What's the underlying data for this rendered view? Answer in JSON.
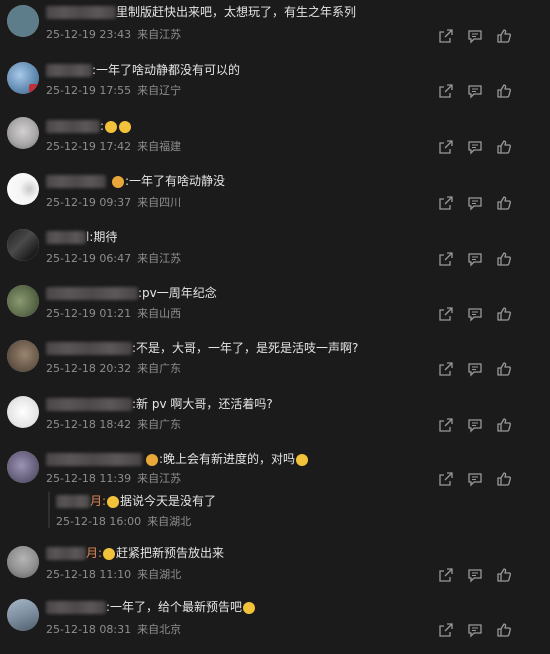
{
  "comments": [
    {
      "id": "c1",
      "avatar_color": "#5d7d8b",
      "name_tail": "",
      "text": "里制版赶快出来吧，太想玩了，有生之年系列",
      "date": "25-12-19 23:43",
      "location": "来自江苏"
    },
    {
      "id": "c2",
      "avatar_color": "#5f89b0",
      "name_tail": "",
      "text": ":一年了啥动静都没有可以的",
      "date": "25-12-19 17:55",
      "location": "来自辽宁"
    },
    {
      "id": "c3",
      "avatar_color": "#a9a7a8",
      "name_tail": "",
      "text": ":",
      "date": "25-12-19 17:42",
      "location": "来自福建"
    },
    {
      "id": "c4",
      "avatar_color": "#f0f0f0",
      "name_tail": "",
      "text": ":一年了有啥动静没",
      "date": "25-12-19 09:37",
      "location": "来自四川"
    },
    {
      "id": "c5",
      "avatar_color": "#3a3a3a",
      "name_tail": "l",
      "text": ":期待",
      "date": "25-12-19 06:47",
      "location": "来自江苏"
    },
    {
      "id": "c6",
      "avatar_color": "#6c7a58",
      "name_tail": "",
      "text": ":pv一周年纪念",
      "date": "25-12-19 01:21",
      "location": "来自山西"
    },
    {
      "id": "c7",
      "avatar_color": "#6b5b4b",
      "name_tail": "",
      "text": ":不是，大哥，一年了，是死是活吱一声啊?",
      "date": "25-12-18 20:32",
      "location": "来自广东"
    },
    {
      "id": "c8",
      "avatar_color": "#e6e6e6",
      "name_tail": "",
      "text": ":新 pv 啊大哥，还活着吗?",
      "date": "25-12-18 18:42",
      "location": "来自广东"
    },
    {
      "id": "c9",
      "avatar_color": "#6b6480",
      "name_tail": "",
      "text": ":晚上会有新进度的，对吗",
      "date": "25-12-18 11:39",
      "location": "来自江苏"
    },
    {
      "id": "c9r",
      "avatar_color": "",
      "name_tail": "月:",
      "text": "据说今天是没有了",
      "date": "25-12-18 16:00",
      "location": "来自湖北"
    },
    {
      "id": "c10",
      "avatar_color": "#8f8f8f",
      "name_tail": "月:",
      "text": "赶紧把新预告放出来",
      "date": "25-12-18 11:10",
      "location": "来自湖北"
    },
    {
      "id": "c11",
      "avatar_color": "#7d8fa0",
      "name_tail": "",
      "text": ":一年了，给个最新预告吧",
      "date": "25-12-18 08:31",
      "location": "来自北京"
    }
  ],
  "icons": {
    "share": "share-icon",
    "comment": "comment-icon",
    "like": "like-icon"
  },
  "colors": {
    "background": "#1b1b1b",
    "name_accent": "#e08a5a"
  }
}
